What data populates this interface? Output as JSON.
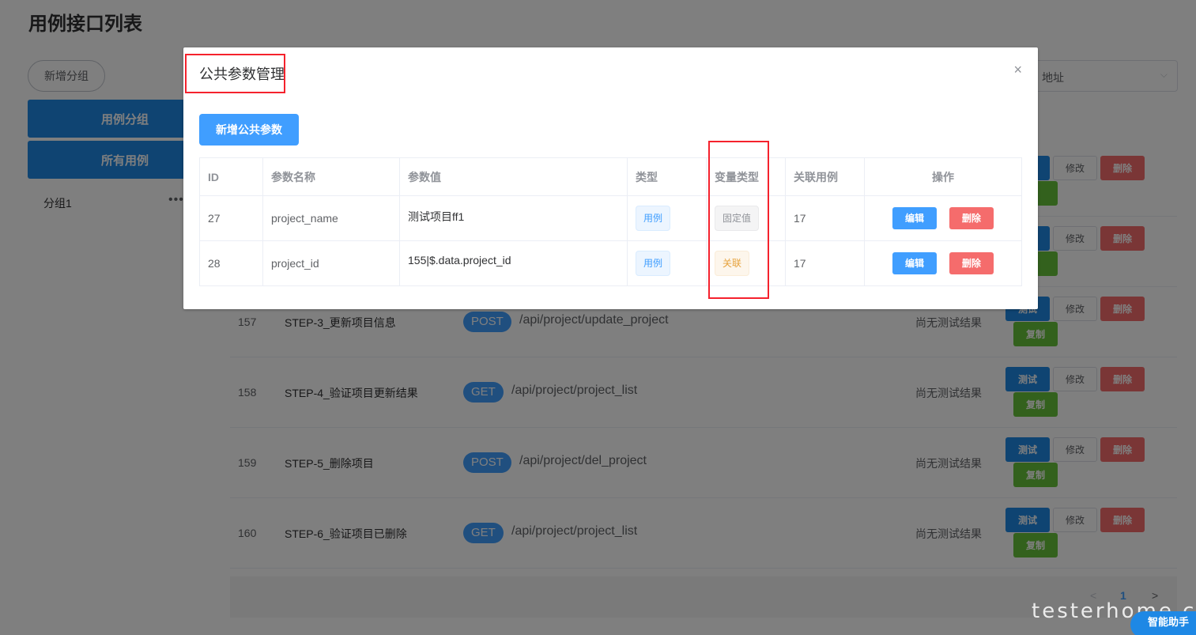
{
  "page": {
    "title": "用例接口列表",
    "add_group_label": "新增分组",
    "sidebar_tabs": [
      "用例分组",
      "所有用例"
    ],
    "group_item": "分组1",
    "group_more": "•••",
    "address_select_text": "地址",
    "address_chevron": "⌵"
  },
  "cases": [
    {
      "id": "157",
      "name": "STEP-3_更新项目信息",
      "method": "POST",
      "path": "/api/project/update_project",
      "result": "尚无测试结果"
    },
    {
      "id": "158",
      "name": "STEP-4_验证项目更新结果",
      "method": "GET",
      "path": "/api/project/project_list",
      "result": "尚无测试结果"
    },
    {
      "id": "159",
      "name": "STEP-5_删除项目",
      "method": "POST",
      "path": "/api/project/del_project",
      "result": "尚无测试结果"
    },
    {
      "id": "160",
      "name": "STEP-6_验证项目已删除",
      "method": "GET",
      "path": "/api/project/project_list",
      "result": "尚无测试结果"
    }
  ],
  "row_actions": {
    "test": "测试",
    "modify": "修改",
    "delete": "删除",
    "copy": "复制"
  },
  "pagination": {
    "prev": "<",
    "current": "1",
    "next": ">"
  },
  "watermark": "testerhome.com",
  "assistant_label": "智能助手",
  "dialog": {
    "title": "公共参数管理",
    "close": "×",
    "new_param_label": "新增公共参数",
    "columns": [
      "ID",
      "参数名称",
      "参数值",
      "类型",
      "变量类型",
      "关联用例",
      "操作"
    ],
    "rows": [
      {
        "id": "27",
        "name": "project_name",
        "value": "测试项目ff1",
        "type": "用例",
        "var_type": "固定值",
        "case": "17"
      },
      {
        "id": "28",
        "name": "project_id",
        "value": "155|$.data.project_id",
        "type": "用例",
        "var_type": "关联",
        "case": "17"
      }
    ],
    "edit_label": "编辑",
    "delete_label": "删除"
  }
}
